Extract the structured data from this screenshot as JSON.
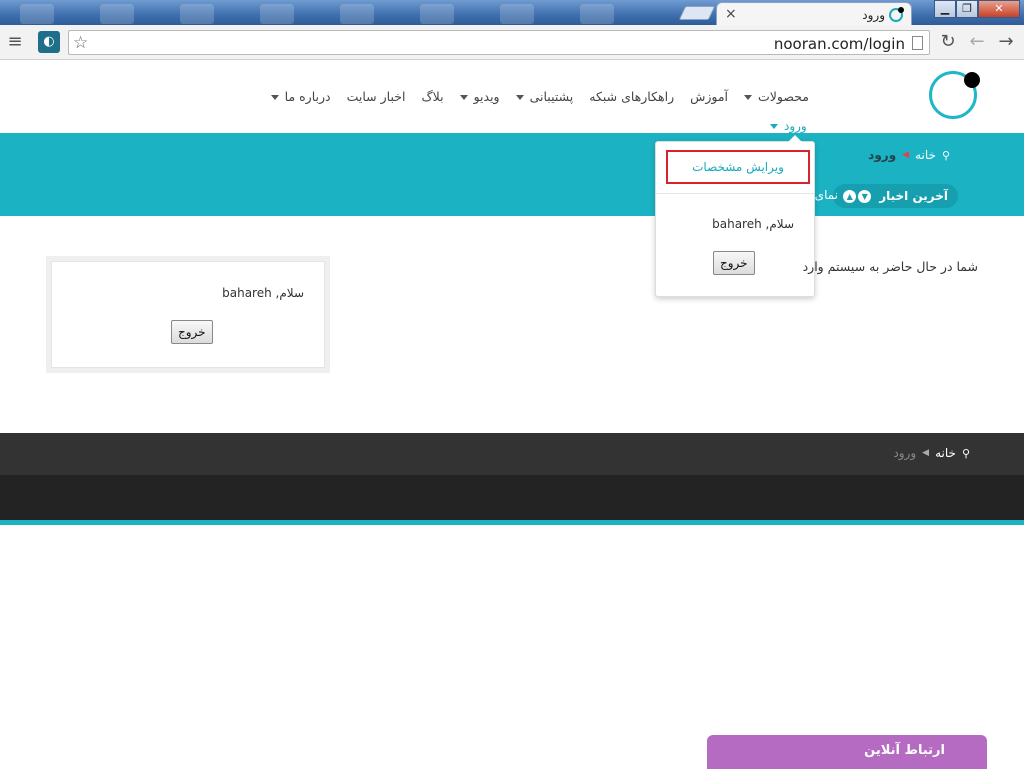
{
  "browser": {
    "tab_title": "ورود",
    "tab_close": "×",
    "url": "nooran.com/login",
    "window_buttons": {
      "minimize": "▁",
      "maximize": "❐",
      "close": "✕"
    },
    "icons": {
      "back": "arrow-left-icon",
      "forward": "arrow-right-icon",
      "reload": "reload-icon",
      "menu": "hamburger-menu-icon",
      "star": "bookmark-star-icon",
      "extension": "nooran-extension-icon",
      "page": "page-document-icon"
    }
  },
  "site": {
    "nav": [
      {
        "label": "محصولات",
        "caret": true
      },
      {
        "label": "آموزش",
        "caret": false
      },
      {
        "label": "راهکارهای شبکه",
        "caret": false
      },
      {
        "label": "پشتیبانی",
        "caret": true
      },
      {
        "label": "ویدیو",
        "caret": true
      },
      {
        "label": "بلاگ",
        "caret": false
      },
      {
        "label": "اخبار سایت",
        "caret": false
      },
      {
        "label": "درباره ما",
        "caret": true
      }
    ],
    "login_link": "ورود",
    "breadcrumb": {
      "home": "خانه",
      "current": "ورود"
    },
    "news_label": "آخرین اخبار",
    "news_ticker": "نمای",
    "dropdown": {
      "edit_profile": "ویرایش مشخصات",
      "greeting": "سلام, bahareh",
      "logout": "خروج"
    },
    "main_text": "شما در حال حاضر به سیستم وارد",
    "login_box": {
      "greeting": "سلام, bahareh",
      "logout": "خروج"
    },
    "footer_breadcrumb": {
      "home": "خانه",
      "current": "ورود"
    },
    "chat_tab": "ارتباط آنلاین"
  },
  "colors": {
    "accent": "#1bb3c3",
    "highlight": "#d6242c",
    "chat": "#b56bc1",
    "footer": "#333333"
  }
}
